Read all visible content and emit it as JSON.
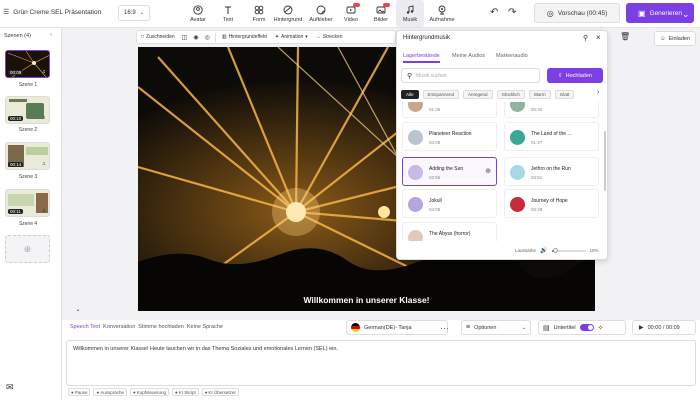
{
  "project": {
    "title": "Grün Creme SEL Präsentation",
    "ratio": "16:9"
  },
  "toolbar": [
    {
      "label": "Avatar",
      "icon": "avatar-icon"
    },
    {
      "label": "Text",
      "icon": "text-icon"
    },
    {
      "label": "Form",
      "icon": "shapes-icon"
    },
    {
      "label": "Hintergrund",
      "icon": "background-icon"
    },
    {
      "label": "Aufkleber",
      "icon": "sticker-icon"
    },
    {
      "label": "Video",
      "icon": "video-icon"
    },
    {
      "label": "Bilder",
      "icon": "image-icon"
    },
    {
      "label": "Musik",
      "icon": "music-icon"
    },
    {
      "label": "Aufnahme",
      "icon": "record-icon"
    }
  ],
  "preview_label": "Vorschau (00:45)",
  "generate_label": "Generieren",
  "invite_label": "Einladen",
  "scenes": {
    "header": "Szenen (4)",
    "items": [
      {
        "label": "Szene 1",
        "duration": "00:09"
      },
      {
        "label": "Szene 2",
        "duration": "00:10"
      },
      {
        "label": "Szene 3",
        "duration": "00:14"
      },
      {
        "label": "Szene 4",
        "duration": "00:11"
      }
    ]
  },
  "edit_tools": {
    "crop": "Zuschneiden",
    "bg_effect": "Hintergrundeffekt",
    "animation": "Animation",
    "stretch": "Strecken"
  },
  "canvas": {
    "subtitle": "Willkommen in unserer Klasse!"
  },
  "music_panel": {
    "title": "Hintergrundmusik",
    "tabs": [
      "Lagerbestände",
      "Meine Audios",
      "Markenaudio"
    ],
    "search_placeholder": "Musik suchen",
    "upload_label": "Hochladen",
    "chips": [
      "Alle",
      "Entspannend",
      "Anregend",
      "Glücklich",
      "Warm",
      "Glatt"
    ],
    "tracks": [
      {
        "name": "",
        "time": "01:35",
        "color": "#c9a78c"
      },
      {
        "name": "",
        "time": "00:32",
        "color": "#8fb3a0"
      },
      {
        "name": "Planeteer Reaction",
        "time": "04:08",
        "color": "#b8c4d0"
      },
      {
        "name": "The Land of the ...",
        "time": "01:47",
        "color": "#3aa896"
      },
      {
        "name": "Adding the Sun",
        "time": "02:56",
        "color": "#c9b9e6"
      },
      {
        "name": "Jethro on the Run",
        "time": "03:51",
        "color": "#a7d8e4"
      },
      {
        "name": "Jokull",
        "time": "04:05",
        "color": "#b5a5e0"
      },
      {
        "name": "Journey of Hope",
        "time": "05:49",
        "color": "#c92b3a"
      },
      {
        "name": "The Abyss (horror)",
        "time": "",
        "color": "#e4c8b8"
      }
    ],
    "volume_label": "Lautstärke",
    "volume_value": "10%",
    "volume_level": 0.1
  },
  "bottom": {
    "tabs": [
      "Speech Text",
      "Konversation",
      "Stimme hochladen",
      "Keine Sprache"
    ],
    "voice": "German(DE)- Tanja",
    "options_label": "Optionen",
    "subtitle_label": "Untertitel",
    "playtime": "00:00 / 00:09",
    "script": "Willkommen in unserer Klasse! Heute tauchen wir in das Thema Soziales und emotionales Lernen (SEL) ein.",
    "footer": [
      "Pause",
      "Aussprache",
      "Kopfsteuerung",
      "KI Skript",
      "KI Übersetzer"
    ]
  },
  "colors": {
    "accent": "#7b3fe4"
  }
}
